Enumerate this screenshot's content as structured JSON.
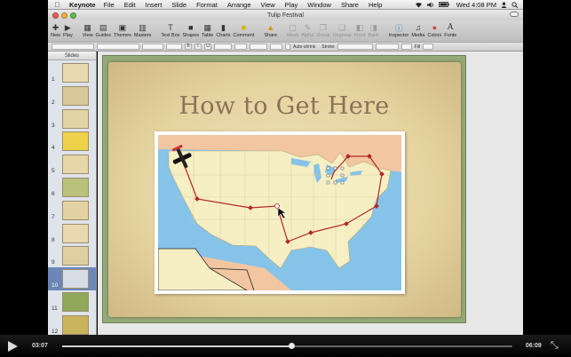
{
  "menubar": {
    "app_name": "Keynote",
    "items": [
      "File",
      "Edit",
      "Insert",
      "Slide",
      "Format",
      "Arrange",
      "View",
      "Play",
      "Window",
      "Share",
      "Help"
    ],
    "clock": "Wed 4:08 PM",
    "icons": [
      "apple-icon",
      "wifi-icon",
      "volume-icon",
      "battery-icon",
      "user-icon",
      "spotlight-icon"
    ]
  },
  "window": {
    "title": "Tulip Festival"
  },
  "toolbar": {
    "buttons": [
      {
        "label": "New",
        "icon": "new-icon",
        "enabled": true
      },
      {
        "label": "Play",
        "icon": "play-icon",
        "enabled": true
      },
      {
        "label": "View",
        "icon": "view-icon",
        "enabled": true
      },
      {
        "label": "Guides",
        "icon": "guides-icon",
        "enabled": true
      },
      {
        "label": "Themes",
        "icon": "themes-icon",
        "enabled": true
      },
      {
        "label": "Masters",
        "icon": "masters-icon",
        "enabled": true
      },
      {
        "label": "Text Box",
        "icon": "textbox-icon",
        "enabled": true
      },
      {
        "label": "Shapes",
        "icon": "shapes-icon",
        "enabled": true
      },
      {
        "label": "Table",
        "icon": "table-icon",
        "enabled": true
      },
      {
        "label": "Charts",
        "icon": "charts-icon",
        "enabled": true
      },
      {
        "label": "Comment",
        "icon": "comment-icon",
        "enabled": true
      },
      {
        "label": "Share",
        "icon": "share-icon",
        "enabled": true
      },
      {
        "label": "Mask",
        "icon": "mask-icon",
        "enabled": false
      },
      {
        "label": "Alpha",
        "icon": "alpha-icon",
        "enabled": false
      },
      {
        "label": "Group",
        "icon": "group-icon",
        "enabled": false
      },
      {
        "label": "Ungroup",
        "icon": "ungroup-icon",
        "enabled": false
      },
      {
        "label": "Front",
        "icon": "front-icon",
        "enabled": false
      },
      {
        "label": "Back",
        "icon": "back-icon",
        "enabled": false
      },
      {
        "label": "Inspector",
        "icon": "inspector-icon",
        "enabled": true
      },
      {
        "label": "Media",
        "icon": "media-icon",
        "enabled": true
      },
      {
        "label": "Colors",
        "icon": "colors-icon",
        "enabled": true
      },
      {
        "label": "Fonts",
        "icon": "fonts-icon",
        "enabled": true
      }
    ]
  },
  "formatbar": {
    "auto_shrink_label": "Auto-shrink",
    "stroke_label": "Stroke",
    "fill_label": "Fill"
  },
  "navigator": {
    "header": "Slides",
    "selected": 10,
    "slides": [
      "1",
      "2",
      "3",
      "4",
      "5",
      "6",
      "7",
      "8",
      "9",
      "10",
      "11",
      "12"
    ]
  },
  "slide": {
    "title": "How to Get Here"
  },
  "video": {
    "elapsed": "03:07",
    "remaining": "06:09",
    "progress": 0.51
  },
  "colors": {
    "route": "#b3262a",
    "land": "#f7efc4",
    "water": "#86c3e8",
    "canada": "#f2c6a0",
    "title": "#8b7059",
    "selection": "#6c86b7"
  }
}
